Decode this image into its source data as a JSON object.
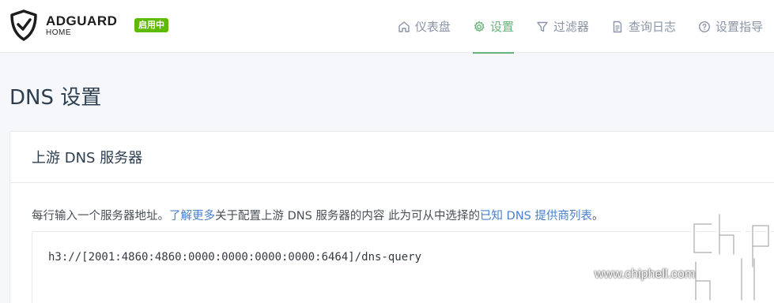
{
  "header": {
    "brand": "ADGUARD",
    "brand_sub": "HOME",
    "status_badge": "启用中"
  },
  "nav": {
    "items": [
      {
        "label": "仪表盘",
        "icon": "home-icon"
      },
      {
        "label": "设置",
        "icon": "gear-icon",
        "active": true
      },
      {
        "label": "过滤器",
        "icon": "filter-icon"
      },
      {
        "label": "查询日志",
        "icon": "document-icon"
      },
      {
        "label": "设置指导",
        "icon": "help-circle-icon"
      }
    ]
  },
  "page": {
    "title": "DNS 设置"
  },
  "upstream": {
    "title": "上游 DNS 服务器",
    "desc_prefix": "每行输入一个服务器地址。",
    "learn_more": "了解更多",
    "desc_middle": "关于配置上游 DNS 服务器的内容 此为可从中选择的",
    "known_providers": "已知 DNS 提供商列表",
    "desc_suffix": "。",
    "servers_value": "h3://[2001:4860:4860:0000:0000:0000:0000:6464]/dns-query"
  },
  "watermark": {
    "site": "www.chiphell.com"
  },
  "colors": {
    "accent": "#67b279",
    "badge": "#5eba00",
    "link": "#467fcf"
  }
}
